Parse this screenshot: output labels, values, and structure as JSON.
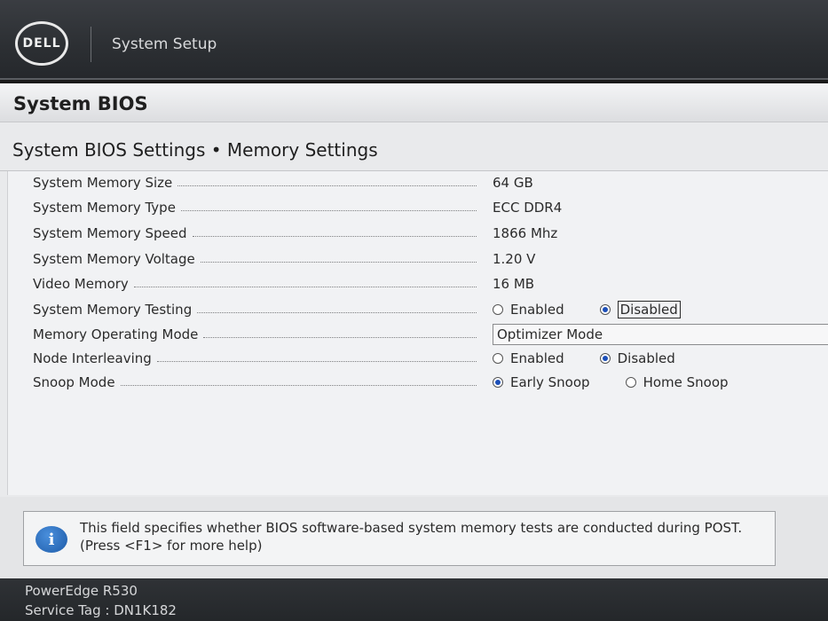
{
  "header": {
    "logo_text": "DELL",
    "title": "System Setup"
  },
  "section_title": "System BIOS",
  "page_heading": "System BIOS Settings • Memory Settings",
  "settings": [
    {
      "label": "System Memory Size",
      "value": "64 GB"
    },
    {
      "label": "System Memory Type",
      "value": "ECC DDR4"
    },
    {
      "label": "System Memory Speed",
      "value": "1866 Mhz"
    },
    {
      "label": "System Memory Voltage",
      "value": "1.20 V"
    },
    {
      "label": "Video Memory",
      "value": "16 MB"
    },
    {
      "label": "System Memory Testing",
      "options": [
        "Enabled",
        "Disabled"
      ],
      "selected": "Disabled"
    },
    {
      "label": "Memory Operating Mode",
      "value": "Optimizer Mode"
    },
    {
      "label": "Node Interleaving",
      "options": [
        "Enabled",
        "Disabled"
      ],
      "selected": "Disabled"
    },
    {
      "label": "Snoop Mode",
      "options": [
        "Early Snoop",
        "Home Snoop"
      ],
      "selected": "Early Snoop"
    }
  ],
  "help": {
    "icon": "info-icon",
    "icon_glyph": "i",
    "text": "This field specifies whether BIOS software-based system memory tests are conducted during POST. (Press <F1> for more help)"
  },
  "footer": {
    "model": "PowerEdge R530",
    "service_tag": "Service Tag : DN1K182"
  },
  "colors": {
    "header_bg": "#2c2f33",
    "panel_bg": "#f1f2f4",
    "radio_selected": "#1c4fb8",
    "info_blue": "#1d5ba8"
  }
}
